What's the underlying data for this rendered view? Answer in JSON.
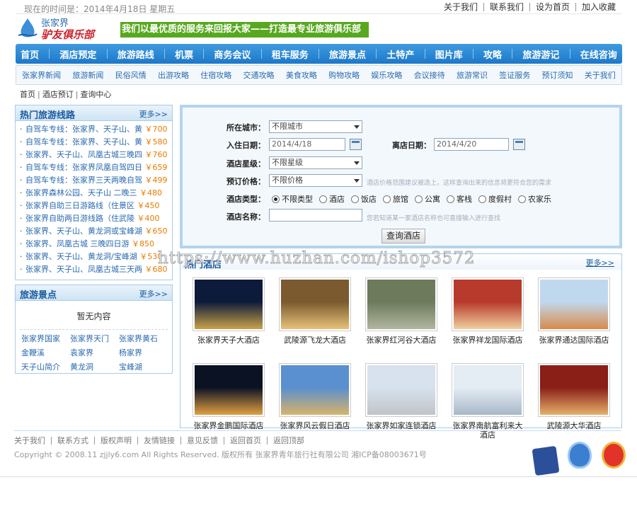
{
  "topbar": {
    "date": "现在的时间是：2014年4月18日 星期五",
    "links": [
      "关于我们",
      "联系我们",
      "设为首页",
      "加入收藏"
    ]
  },
  "logo": {
    "line1": "张家界",
    "line2": "驴友俱乐部"
  },
  "slogan": "我们以最优质的服务来回报大家——打造最专业旅游俱乐部",
  "main_nav": [
    "首页",
    "酒店预定",
    "旅游路线",
    "机票",
    "商务会议",
    "租车服务",
    "旅游景点",
    "土特产",
    "图片库",
    "攻略",
    "旅游游记",
    "在线咨询"
  ],
  "sub_nav": [
    "张家界新闻",
    "旅游新闻",
    "民俗风情",
    "出游攻略",
    "住宿攻略",
    "交通攻略",
    "美食攻略",
    "购物攻略",
    "娱乐攻略",
    "会议接待",
    "旅游常识",
    "签证服务",
    "预订须知",
    "关于我们"
  ],
  "breadcrumb": [
    "首页",
    "酒店预订",
    "查询中心"
  ],
  "hot_routes": {
    "title": "热门旅游线路",
    "more": "更多>>",
    "items": [
      {
        "name": "自驾车专线：张家界、天子山、黄",
        "price": "￥700"
      },
      {
        "name": "自驾车专线：张家界、天子山、黄",
        "price": "￥580"
      },
      {
        "name": "张家界、天子山、凤凰古城三晚四",
        "price": "￥760"
      },
      {
        "name": "自驾车专线：张家界凤凰自驾四日",
        "price": "￥659"
      },
      {
        "name": "自驾车专线：张家界三天两晚自驾",
        "price": "￥499"
      },
      {
        "name": "张家界森林公园、天子山 二晚三",
        "price": "￥480"
      },
      {
        "name": "张家界自助三日游路线（住景区",
        "price": "￥450"
      },
      {
        "name": "张家界自助两日游线路（住武陵",
        "price": "￥400"
      },
      {
        "name": "张家界、天子山、黄龙洞或宝峰湖",
        "price": "￥650"
      },
      {
        "name": "张家界、凤凰古城 三晚四日游",
        "price": "￥850"
      },
      {
        "name": "张家界、天子山、黄龙洞/宝峰湖",
        "price": "￥530"
      },
      {
        "name": "张家界、天子山、凤凰古城三天两",
        "price": "￥680"
      }
    ]
  },
  "scenic": {
    "title": "旅游景点",
    "more": "更多>>",
    "empty": "暂无内容",
    "items": [
      "张家界国家",
      "张家界天门",
      "张家界黄石",
      "金鞭溪",
      "袁家界",
      "杨家界",
      "天子山简介",
      "黄龙洞",
      "宝峰湖"
    ]
  },
  "search_form": {
    "city_label": "所在城市：",
    "city_value": "不限城市",
    "checkin_label": "入住日期：",
    "checkin_value": "2014/4/18",
    "checkout_label": "离店日期：",
    "checkout_value": "2014/4/20",
    "star_label": "酒店星级：",
    "star_value": "不限星级",
    "price_label": "预订价格：",
    "price_value": "不限价格",
    "price_hint": "酒店价格范围建议被选上，这样查询出来的信息将更符合您的需求",
    "type_label": "酒店类型：",
    "types": [
      "不限类型",
      "酒店",
      "饭店",
      "旅馆",
      "公寓",
      "客栈",
      "度假村",
      "农家乐"
    ],
    "name_label": "酒店名称：",
    "name_value": "",
    "name_hint": "您若知道某一家酒店名称也可直接输入进行查找",
    "submit": "查询酒店"
  },
  "hotels": {
    "title": "热门酒店",
    "more": "更多>>",
    "items": [
      {
        "name": "张家界天子大酒店",
        "colors": [
          "#0d1b3a",
          "#c9a34a"
        ]
      },
      {
        "name": "武陵源飞龙大酒店",
        "colors": [
          "#7a5a2e",
          "#e8c27a"
        ]
      },
      {
        "name": "张家界红河谷大酒店",
        "colors": [
          "#6d7a5c",
          "#b2b6a0"
        ]
      },
      {
        "name": "张家界祥龙国际酒店",
        "colors": [
          "#b73a2c",
          "#f0d0a0"
        ]
      },
      {
        "name": "张家界通达国际酒店",
        "colors": [
          "#c0d8ee",
          "#d88a4a"
        ]
      },
      {
        "name": "张家界金鹏国际酒店",
        "colors": [
          "#0b1224",
          "#e2a040"
        ]
      },
      {
        "name": "张家界风云假日酒店",
        "colors": [
          "#5a8fd0",
          "#d7b36a"
        ]
      },
      {
        "name": "张家界如家连锁酒店",
        "colors": [
          "#d7e2ee",
          "#c0c4c8"
        ]
      },
      {
        "name": "张家界南航富利来大酒店",
        "colors": [
          "#e4ecf4",
          "#a8b8c8"
        ]
      },
      {
        "name": "武陵源大华酒店",
        "colors": [
          "#8a1f18",
          "#e6b06a"
        ]
      }
    ]
  },
  "watermark": "https://www.huzhan.com/ishop3572",
  "footer": {
    "links": [
      "关于我们",
      "联系方式",
      "版权声明",
      "友情链接",
      "意见反馈",
      "返回首页",
      "返回顶部"
    ],
    "copyright": "Copyright © 2008.11 zjjly6.com  All Rights Reserved.  版权所有 张家界青年旅行社有限公司  湘ICP备08003671号"
  }
}
